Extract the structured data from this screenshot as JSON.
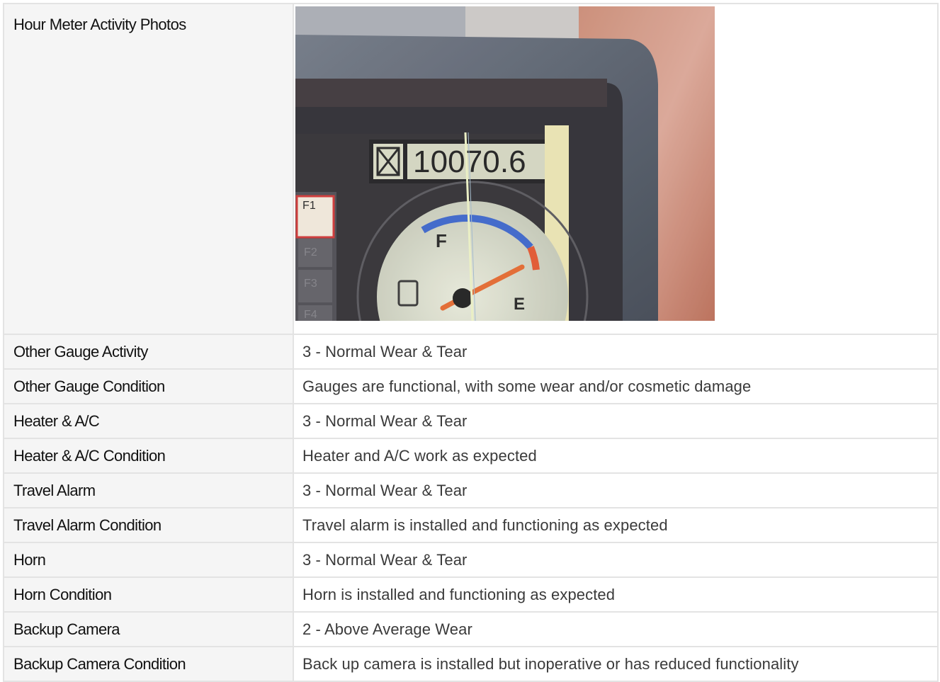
{
  "photo_row": {
    "label": "Hour Meter Activity Photos",
    "photo": {
      "icon": "hour-meter-photo",
      "readout": "10070.6",
      "gauge_letters": [
        "F",
        "E"
      ],
      "button_labels": [
        "F1",
        "F2",
        "F3",
        "F4"
      ]
    }
  },
  "rows": [
    {
      "label": "Other Gauge Activity",
      "value": "3 - Normal Wear & Tear"
    },
    {
      "label": "Other Gauge Condition",
      "value": "Gauges are functional, with some wear and/or cosmetic damage"
    },
    {
      "label": "Heater & A/C",
      "value": "3 - Normal Wear & Tear"
    },
    {
      "label": "Heater & A/C Condition",
      "value": "Heater and A/C work as expected"
    },
    {
      "label": "Travel Alarm",
      "value": "3 - Normal Wear & Tear"
    },
    {
      "label": "Travel Alarm Condition",
      "value": "Travel alarm is installed and functioning as expected"
    },
    {
      "label": "Horn",
      "value": "3 - Normal Wear & Tear"
    },
    {
      "label": "Horn Condition",
      "value": "Horn is installed and functioning as expected"
    },
    {
      "label": "Backup Camera",
      "value": "2 - Above Average Wear"
    },
    {
      "label": "Backup Camera Condition",
      "value": "Back up camera is installed but inoperative or has reduced functionality"
    }
  ]
}
